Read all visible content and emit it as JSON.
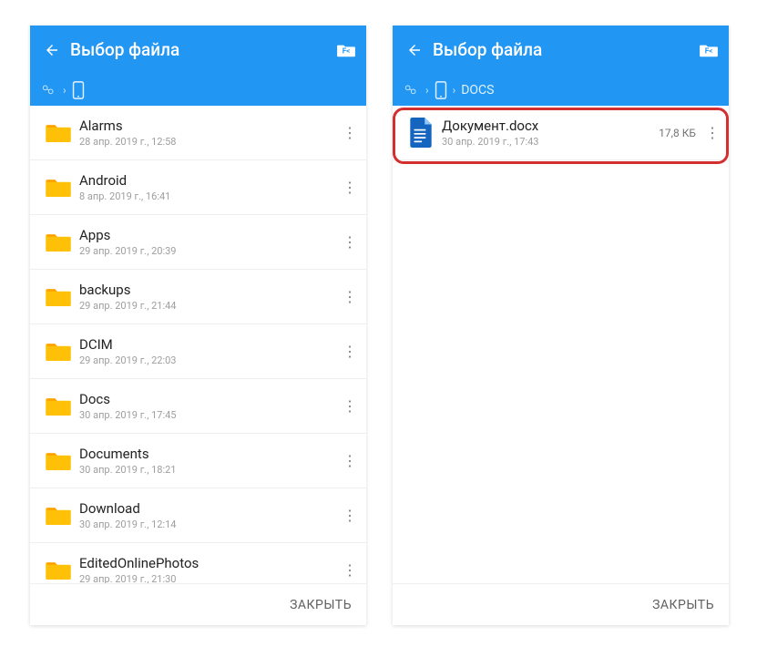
{
  "common": {
    "title": "Выбор файла",
    "close_label": "ЗАКРЫТЬ"
  },
  "left": {
    "breadcrumb": {
      "docs": null
    },
    "items": [
      {
        "name": "Alarms",
        "meta": "28 апр. 2019 г., 12:58"
      },
      {
        "name": "Android",
        "meta": "8 апр. 2019 г., 16:41"
      },
      {
        "name": "Apps",
        "meta": "29 апр. 2019 г., 20:39"
      },
      {
        "name": "backups",
        "meta": "29 апр. 2019 г., 21:44"
      },
      {
        "name": "DCIM",
        "meta": "29 апр. 2019 г., 22:03"
      },
      {
        "name": "Docs",
        "meta": "30 апр. 2019 г., 17:45"
      },
      {
        "name": "Documents",
        "meta": "30 апр. 2019 г., 18:21"
      },
      {
        "name": "Download",
        "meta": "30 апр. 2019 г., 12:14"
      },
      {
        "name": "EditedOnlinePhotos",
        "meta": "29 апр. 2019 г., 21:30"
      }
    ]
  },
  "right": {
    "breadcrumb": {
      "docs": "DOCS"
    },
    "file": {
      "name": "Документ.docx",
      "meta": "30 апр. 2019 г., 17:43",
      "size": "17,8 КБ"
    }
  }
}
